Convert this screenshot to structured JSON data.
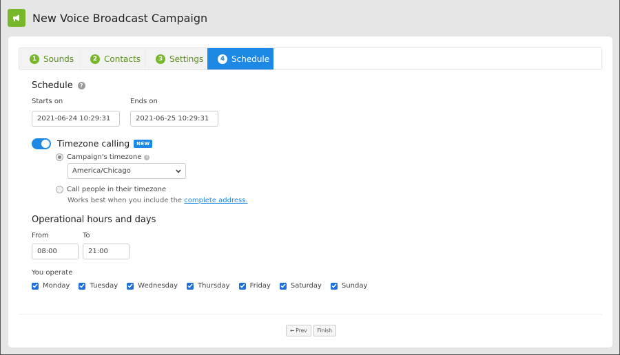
{
  "header": {
    "title": "New Voice Broadcast Campaign",
    "icon": "megaphone-icon",
    "accent_color": "#76b82a"
  },
  "tabs": [
    {
      "number": "1",
      "label": "Sounds",
      "active": false
    },
    {
      "number": "2",
      "label": "Contacts",
      "active": false
    },
    {
      "number": "3",
      "label": "Settings",
      "active": false
    },
    {
      "number": "4",
      "label": "Schedule",
      "active": true
    }
  ],
  "schedule": {
    "title": "Schedule",
    "help_icon": "?",
    "starts_on_label": "Starts on",
    "starts_on_value": "2021-06-24 10:29:31",
    "ends_on_label": "Ends on",
    "ends_on_value": "2021-06-25 10:29:31"
  },
  "timezone": {
    "toggle_label": "Timezone calling",
    "toggle_on": true,
    "badge": "NEW",
    "option_campaign_label": "Campaign's timezone",
    "option_campaign_selected": true,
    "info_icon": "i",
    "timezone_value": "America/Chicago",
    "option_people_label": "Call people in their timezone",
    "option_people_selected": false,
    "hint_text": "Works best when you include the",
    "hint_link": "complete address."
  },
  "operational": {
    "title": "Operational hours and days",
    "from_label": "From",
    "from_value": "08:00",
    "to_label": "To",
    "to_value": "21:00",
    "operate_label": "You operate",
    "days": [
      {
        "label": "Monday",
        "checked": true
      },
      {
        "label": "Tuesday",
        "checked": true
      },
      {
        "label": "Wednesday",
        "checked": true
      },
      {
        "label": "Thursday",
        "checked": true
      },
      {
        "label": "Friday",
        "checked": true
      },
      {
        "label": "Saturday",
        "checked": true
      },
      {
        "label": "Sunday",
        "checked": true
      }
    ]
  },
  "footer": {
    "prev_label": "Prev",
    "prev_icon": "←",
    "finish_label": "Finish"
  },
  "colors": {
    "primary_blue": "#1e88e5",
    "green": "#76b82a"
  }
}
